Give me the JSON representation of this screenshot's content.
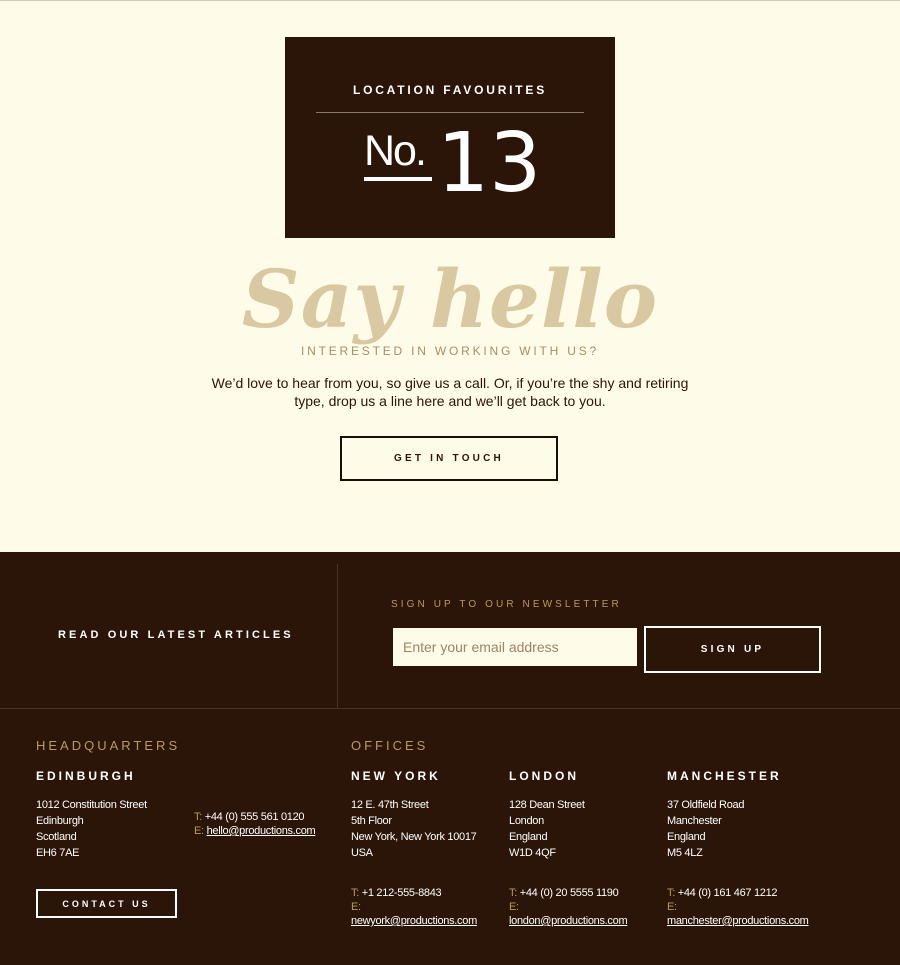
{
  "badge": {
    "title": "LOCATION FAVOURITES",
    "no": "No.",
    "number": "13"
  },
  "hero": {
    "script_title": "Say hello",
    "subtitle": "INTERESTED IN WORKING WITH US?",
    "body": "We’d love to hear from you, so give us a call. Or, if you’re the shy and retiring type, drop us a line here and we’ll get back to you.",
    "cta": "GET IN TOUCH"
  },
  "footer_top": {
    "articles_link": "READ OUR LATEST ARTICLES",
    "newsletter_label": "SIGN UP TO OUR NEWSLETTER",
    "email_placeholder": "Enter your email address",
    "signup_button": "SIGN UP"
  },
  "headquarters": {
    "section_label": "HEADQUARTERS",
    "city": "EDINBURGH",
    "address": [
      "1012 Constitution Street",
      "Edinburgh",
      "Scotland",
      "EH6 7AE"
    ],
    "phone_label": "T:",
    "phone": "+44 (0) 555 561 0120",
    "email_label": "E:",
    "email": "hello@productions.com",
    "contact_button": "CONTACT US"
  },
  "offices": {
    "section_label": "OFFICES",
    "items": [
      {
        "city": "NEW YORK",
        "address": [
          "12 E. 47th Street",
          "5th Floor",
          "New York, New York 10017",
          "USA"
        ],
        "phone_label": "T:",
        "phone": "+1 212-555-8843",
        "email_label": "E:",
        "email": "newyork@productions.com"
      },
      {
        "city": "LONDON",
        "address": [
          "128 Dean Street",
          "London",
          "England",
          "W1D 4QF"
        ],
        "phone_label": "T:",
        "phone": "+44 (0) 20 5555 1190",
        "email_label": "E:",
        "email": "london@productions.com"
      },
      {
        "city": "MANCHESTER",
        "address": [
          "37 Oldfield Road",
          "Manchester",
          "England",
          "M5 4LZ"
        ],
        "phone_label": "T:",
        "phone": "+44 (0) 161 467 1212",
        "email_label": "E:",
        "email": "manchester@productions.com"
      }
    ]
  },
  "colors": {
    "cream": "#fffbe9",
    "dark_brown": "#2b1408",
    "gold": "#b89a63",
    "script_tan": "#d9c9a2"
  }
}
